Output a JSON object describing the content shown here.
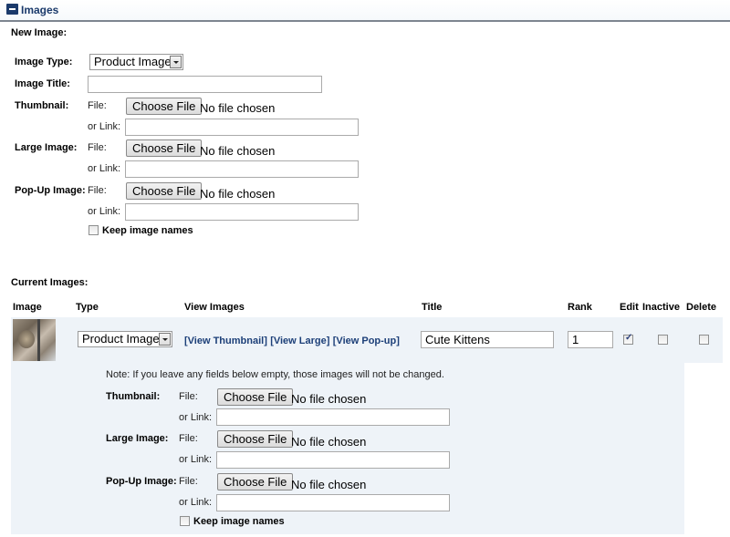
{
  "header": {
    "title": "Images",
    "icon": "collapse-icon"
  },
  "new_image": {
    "heading": "New Image:",
    "image_type": {
      "label": "Image Type:",
      "value": "Product Image"
    },
    "image_title": {
      "label": "Image Title:",
      "value": ""
    },
    "thumbnail": {
      "label": "Thumbnail:",
      "file_label": "File:",
      "button": "Choose File",
      "status": "No file chosen",
      "link_label": "or Link:",
      "link_value": ""
    },
    "large": {
      "label": "Large Image:",
      "file_label": "File:",
      "button": "Choose File",
      "status": "No file chosen",
      "link_label": "or Link:",
      "link_value": ""
    },
    "popup": {
      "label": "Pop-Up Image:",
      "file_label": "File:",
      "button": "Choose File",
      "status": "No file chosen",
      "link_label": "or Link:",
      "link_value": ""
    },
    "keep_names": {
      "label": "Keep image names",
      "checked": false
    }
  },
  "current_images": {
    "heading": "Current Images:",
    "columns": [
      "Image",
      "Type",
      "View Images",
      "Title",
      "Rank",
      "Edit",
      "Inactive",
      "Delete"
    ],
    "rows": [
      {
        "thumbnail_alt": "kitten thumbnail",
        "type": "Product Image",
        "links": [
          "[View Thumbnail]",
          "[View Large]",
          "[View Pop-up]"
        ],
        "title": "Cute Kittens",
        "rank": "1",
        "edit": true,
        "inactive": false,
        "delete": false
      }
    ],
    "edit_panel": {
      "note": "Note: If you leave any fields below empty, those images will not be changed.",
      "thumbnail": {
        "label": "Thumbnail:",
        "file_label": "File:",
        "button": "Choose File",
        "status": "No file chosen",
        "link_label": "or Link:",
        "link_value": ""
      },
      "large": {
        "label": "Large Image:",
        "file_label": "File:",
        "button": "Choose File",
        "status": "No file chosen",
        "link_label": "or Link:",
        "link_value": ""
      },
      "popup": {
        "label": "Pop-Up Image:",
        "file_label": "File:",
        "button": "Choose File",
        "status": "No file chosen",
        "link_label": "or Link:",
        "link_value": ""
      },
      "keep_names": {
        "label": "Keep image names",
        "checked": false
      }
    }
  }
}
